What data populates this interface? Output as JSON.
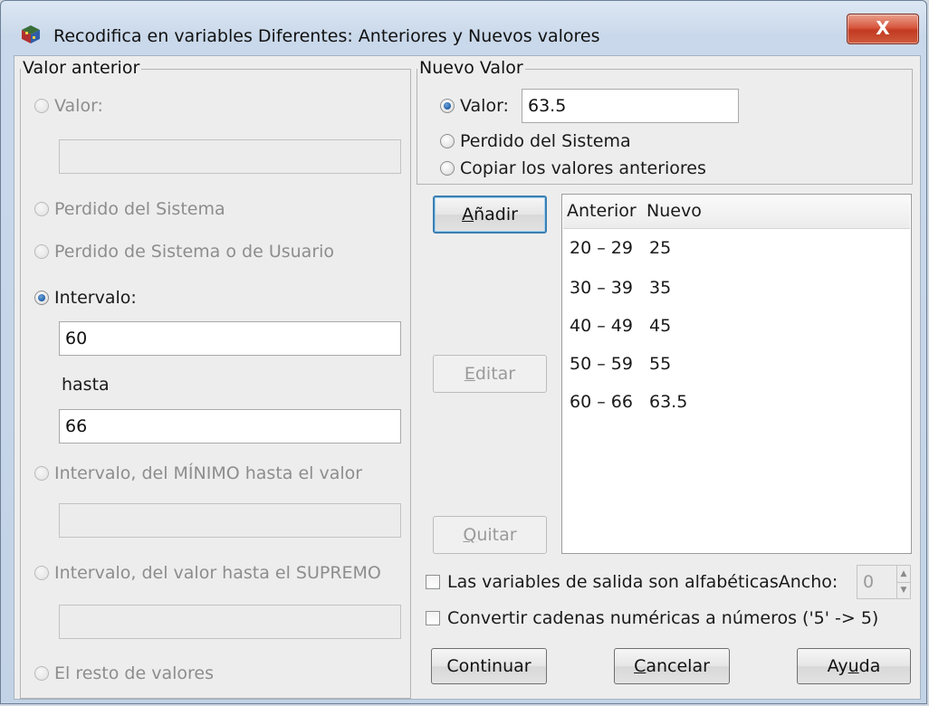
{
  "window": {
    "title": "Recodifica en variables Diferentes: Anteriores y Nuevos valores",
    "close_label": "X"
  },
  "old_value": {
    "group_title": "Valor anterior",
    "value_label": "Valor:",
    "value_input": "",
    "system_missing_label": "Perdido del Sistema",
    "system_or_user_missing_label": "Perdido de Sistema o de Usuario",
    "range_label": "Intervalo:",
    "range_from": "60",
    "through_label": "hasta",
    "range_to": "66",
    "lowest_through_label": "Intervalo, del MÍNIMO hasta el valor",
    "lowest_through_input": "",
    "through_highest_label": "Intervalo, del valor hasta el SUPREMO",
    "through_highest_input": "",
    "all_other_label": "El resto de valores",
    "selected": "range"
  },
  "new_value": {
    "group_title": "Nuevo Valor",
    "value_label": "Valor:",
    "value_input": "63.5",
    "system_missing_label": "Perdido del Sistema",
    "copy_old_label": "Copiar los valores anteriores",
    "selected": "value"
  },
  "buttons": {
    "add_mnemonic": "A",
    "add_rest": "ñadir",
    "edit_mnemonic": "E",
    "edit_rest": "ditar",
    "remove_mnemonic": "Q",
    "remove_rest": "uitar",
    "continue": "Continuar",
    "cancel_mnemonic": "C",
    "cancel_rest": "ancelar",
    "help_prefix": "Ay",
    "help_mnemonic": "u",
    "help_suffix": "da"
  },
  "mappings": {
    "header_old": "Anterior",
    "header_new": "Nuevo",
    "rows": [
      {
        "old": "20 – 29",
        "new": "25"
      },
      {
        "old": "30 – 39",
        "new": "35"
      },
      {
        "old": "40 – 49",
        "new": "45"
      },
      {
        "old": "50 – 59",
        "new": "55"
      },
      {
        "old": "60 – 66",
        "new": "63.5"
      }
    ]
  },
  "options": {
    "string_output_label": "Las variables de salida son alfabéticasAncho:",
    "width_value": "0",
    "convert_label": "Convertir cadenas numéricas a números ('5' -> 5)"
  }
}
